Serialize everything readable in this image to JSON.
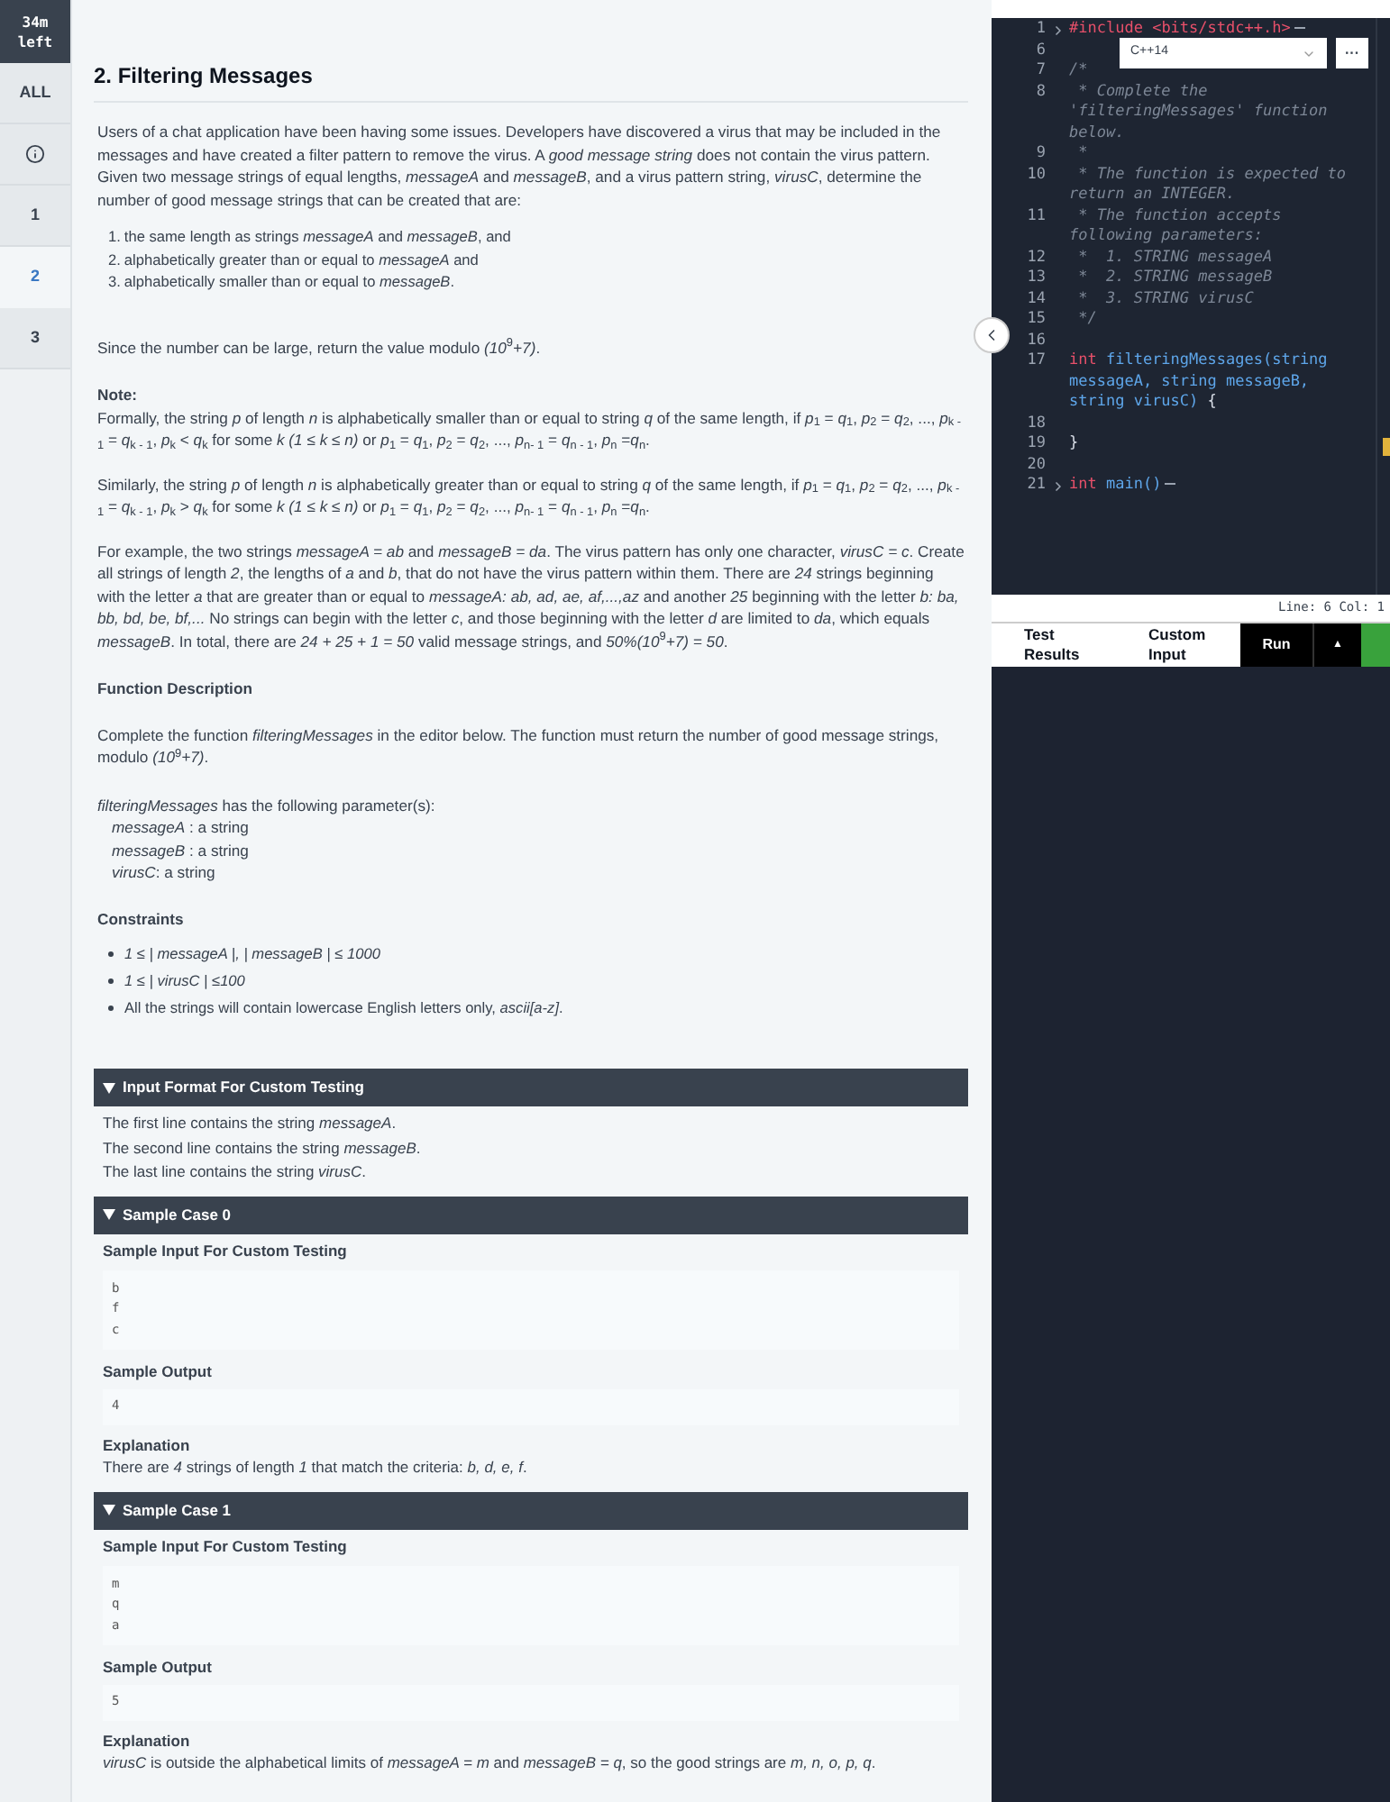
{
  "sidebar": {
    "timer": "34m left",
    "items": [
      {
        "kind": "text",
        "label": "ALL",
        "selected": false
      },
      {
        "kind": "info",
        "selected": false
      },
      {
        "kind": "text",
        "label": "1",
        "selected": false
      },
      {
        "kind": "text",
        "label": "2",
        "selected": true
      },
      {
        "kind": "text",
        "label": "3",
        "selected": false
      }
    ]
  },
  "problem": {
    "title": "2. Filtering Messages",
    "intro": "Users of a chat application have been having some issues. Developers have discovered a virus that may be included in the messages and have created a filter pattern to remove the virus. A *good message string* does not contain the virus pattern. Given two message strings of equal lengths, *messageA* and *messageB*, and a virus pattern string, *virusC*, determine the number of good message strings that can be created that are:",
    "conditions": [
      {
        "number": "1.",
        "text": "the same length as strings *messageA* and *messageB*, and"
      },
      {
        "number": "2.",
        "text": "alphabetically greater than or equal to *messageA* and"
      },
      {
        "number": "3.",
        "text": "alphabetically smaller than or equal to *messageB*."
      }
    ],
    "modulo": "Since the number can be large, return the value modulo *(10*$^{9}$*+7)*.",
    "note_label": "Note:",
    "notes": [
      "Formally, the string *p* of length *n* is alphabetically smaller than or equal to string *q* of the same length, if *p*$_{1}$ = *q*$_{1}$, *p*$_{2}$ = *q*$_{2}$, ..., *p*$_{k - 1}$ = *q*$_{k - 1}$, *p*$_{k}$ < *q*$_{k}$ for some *k (1 ≤ k ≤ n)* or *p*$_{1}$ = *q*$_{1}$, *p*$_{2}$ = *q*$_{2}$, ..., *p*$_{n- 1}$ = *q*$_{n - 1}$, *p*$_{n}$ =*q*$_{n}$.",
      "Similarly, the string *p* of length *n* is alphabetically greater than or equal to string *q* of the same length, if *p*$_{1}$ = *q*$_{1}$, *p*$_{2}$ = *q*$_{2}$, ..., *p*$_{k - 1}$ = *q*$_{k - 1}$, *p*$_{k}$ > *q*$_{k}$ for some *k (1 ≤ k ≤ n)* or *p*$_{1}$ = *q*$_{1}$, *p*$_{2}$ = *q*$_{2}$, ..., *p*$_{n- 1}$ = *q*$_{n - 1}$, *p*$_{n}$ =*q*$_{n}$.",
      "For example, the two strings *messageA = ab* and *messageB = da*.  The virus pattern has only one character, *virusC = c*.  Create all strings of length *2*, the lengths of *a* and *b*, that do not have the virus pattern within them. There are *24* strings beginning with the letter *a* that are greater than or equal to *messageA: ab, ad, ae, af,...,az* and another *25* beginning with the letter *b: ba, bb, bd, be, bf,...* No strings can begin with the letter *c*, and those beginning with the letter *d* are limited to *da*, which equals *messageB*.  In total, there are *24 + 25 + 1 = 50* valid message strings, and *50%(10*$^{9}$*+7) = 50*."
    ],
    "function_heading": "Function Description",
    "function_text": "Complete the function *filteringMessages* in the editor below. The function must return the number of good message strings, modulo *(10*$^{9}$*+7)*.",
    "params_intro": "*filteringMessages* has the following parameter(s):",
    "params": [
      "*messageA* : a string",
      "*messageB* : a string",
      "*virusC*: a string"
    ],
    "constraints_heading": "Constraints",
    "constraints": [
      "*1 ≤ | messageA |, | messageB | ≤ 1000*",
      "*1 ≤ | virusC | ≤100*",
      "All the strings will contain lowercase English letters only, *ascii[a-z]*."
    ],
    "sections": [
      {
        "kind": "text",
        "title": "Input Format For Custom Testing",
        "expanded": true,
        "lines": [
          "The first line contains the string *messageA*.",
          "The second line contains the string *messageB*.",
          "The last line contains the string *virusC*."
        ]
      },
      {
        "kind": "sample",
        "title": "Sample Case 0",
        "expanded": true,
        "input_heading": "Sample Input For Custom Testing",
        "input": [
          "b",
          "f",
          "c"
        ],
        "output_heading": "Sample Output",
        "output": "4",
        "explanation_heading": "Explanation",
        "explanation": "There are *4* strings of length  *1* that match the criteria: *b, d, e, f*."
      },
      {
        "kind": "sample",
        "title": "Sample Case 1",
        "expanded": true,
        "input_heading": "Sample Input For Custom Testing",
        "input": [
          "m",
          "q",
          "a"
        ],
        "output_heading": "Sample Output",
        "output": "5",
        "explanation_heading": "Explanation",
        "explanation": "*virusC* is outside the alphabetical limits of *messageA = m* and *messageB = q*, so the good strings are *m, n, o, p, q*."
      }
    ]
  },
  "editor": {
    "language": "C++14",
    "more": "···",
    "lines": [
      {
        "num": "1",
        "folded": true,
        "tokens": [
          {
            "kind": "keyword",
            "text": "#include"
          },
          {
            "kind": "keyword",
            "text": " <bits/stdc++.h>"
          }
        ]
      },
      {
        "num": "6",
        "folded": false
      },
      {
        "num": "7",
        "folded": false,
        "tokens": [
          {
            "kind": "comment",
            "text": "/*"
          }
        ]
      },
      {
        "num": "8",
        "folded": false,
        "tokens": [
          {
            "kind": "comment",
            "text": " * Complete the 'filteringMessages' function below."
          }
        ]
      },
      {
        "num": "9",
        "folded": false,
        "tokens": [
          {
            "kind": "comment",
            "text": " *"
          }
        ]
      },
      {
        "num": "10",
        "folded": false,
        "tokens": [
          {
            "kind": "comment",
            "text": " * The function is expected to return an INTEGER."
          }
        ]
      },
      {
        "num": "11",
        "folded": false,
        "tokens": [
          {
            "kind": "comment",
            "text": " * The function accepts following parameters:"
          }
        ]
      },
      {
        "num": "12",
        "folded": false,
        "tokens": [
          {
            "kind": "comment",
            "text": " *  1. STRING messageA"
          }
        ]
      },
      {
        "num": "13",
        "folded": false,
        "tokens": [
          {
            "kind": "comment",
            "text": " *  2. STRING messageB"
          }
        ]
      },
      {
        "num": "14",
        "folded": false,
        "tokens": [
          {
            "kind": "comment",
            "text": " *  3. STRING virusC"
          }
        ]
      },
      {
        "num": "15",
        "folded": false,
        "tokens": [
          {
            "kind": "comment",
            "text": " */"
          }
        ]
      },
      {
        "num": "16",
        "folded": false
      },
      {
        "num": "17",
        "folded": false,
        "tokens": [
          {
            "kind": "keyword",
            "text": "int"
          },
          {
            "kind": "name",
            "text": " filteringMessages(string messageA, string messageB, string virusC)"
          },
          {
            "kind": "plain",
            "text": " {"
          }
        ]
      },
      {
        "num": "18",
        "folded": false
      },
      {
        "num": "19",
        "folded": false,
        "tokens": [
          {
            "kind": "plain",
            "text": "}"
          }
        ]
      },
      {
        "num": "20",
        "folded": false
      },
      {
        "num": "21",
        "folded": true,
        "tokens": [
          {
            "kind": "keyword",
            "text": "int"
          },
          {
            "kind": "name",
            "text": " main()"
          }
        ]
      }
    ],
    "status": "Line: 6 Col: 1",
    "tabs": [
      {
        "label": "Test Results",
        "selected": false
      },
      {
        "label": "Custom Input",
        "selected": false
      }
    ],
    "run": "Run",
    "expand": "▲"
  }
}
